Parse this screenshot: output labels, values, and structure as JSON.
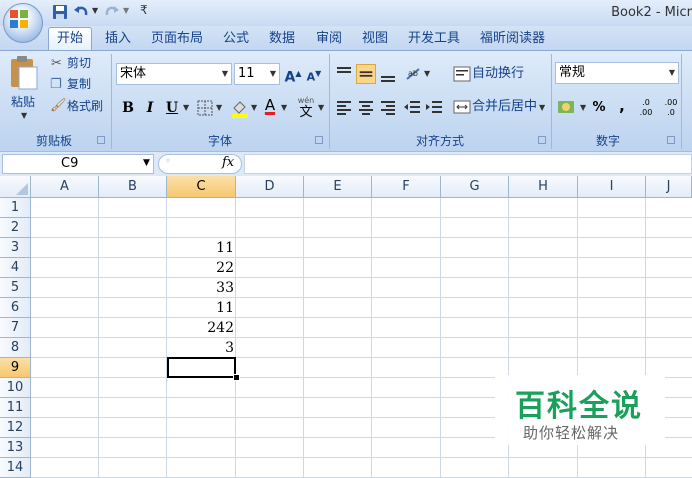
{
  "window": {
    "title": "Book2 - Micr"
  },
  "tabs": [
    "开始",
    "插入",
    "页面布局",
    "公式",
    "数据",
    "审阅",
    "视图",
    "开发工具",
    "福昕阅读器"
  ],
  "clipboard": {
    "paste": "粘贴",
    "cut": "剪切",
    "copy": "复制",
    "format_painter": "格式刷",
    "label": "剪贴板"
  },
  "font": {
    "name": "宋体",
    "size": "11",
    "bold": "B",
    "italic": "I",
    "underline": "U",
    "phonetic": "wén",
    "label": "字体",
    "font_color": "#e02020",
    "highlight_color": "#ffff00"
  },
  "alignment": {
    "wrap_text": "自动换行",
    "merge_center": "合并后居中",
    "label": "对齐方式"
  },
  "number": {
    "format": "常规",
    "percent": "%",
    "comma": ",",
    "increase_decimal": ".00→.0",
    "decrease_decimal": ".0→.00",
    "label": "数字"
  },
  "formula_bar": {
    "name_box": "C9",
    "fx": "fx",
    "formula": ""
  },
  "columns": [
    "A",
    "B",
    "C",
    "D",
    "E",
    "F",
    "G",
    "H",
    "I",
    "J"
  ],
  "rows": [
    "1",
    "2",
    "3",
    "4",
    "5",
    "6",
    "7",
    "8",
    "9",
    "10",
    "11",
    "12",
    "13",
    "14"
  ],
  "cells_c": [
    "",
    "",
    "11",
    "22",
    "33",
    "11",
    "242",
    "3",
    "",
    "",
    "",
    "",
    "",
    ""
  ],
  "selected_cell": {
    "column": "C",
    "row": "9"
  },
  "watermark": {
    "title": "百科全说",
    "subtitle": "助你轻松解决",
    "color": "#1aa05a"
  }
}
